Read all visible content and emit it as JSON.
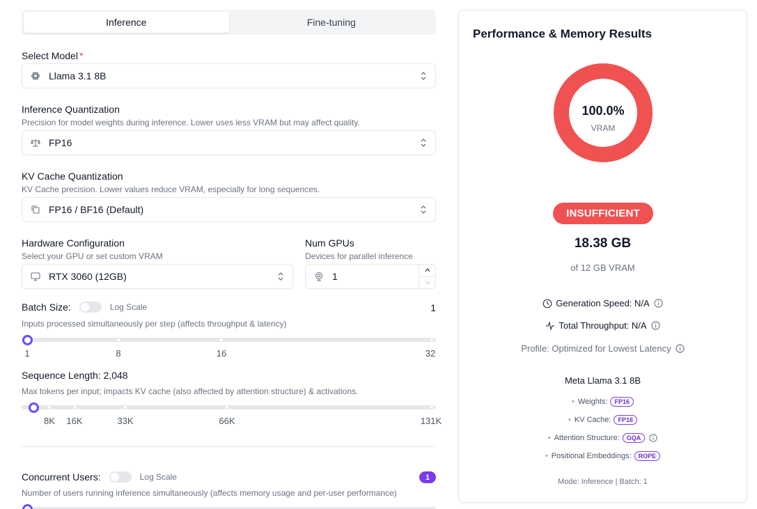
{
  "tabs": [
    {
      "label": "Inference",
      "active": true
    },
    {
      "label": "Fine-tuning",
      "active": false
    }
  ],
  "model": {
    "label": "Select Model",
    "required_mark": "*",
    "value": "Llama 3.1 8B",
    "icon": "openai-logo-icon"
  },
  "inference_quant": {
    "label": "Inference Quantization",
    "help": "Precision for model weights during inference. Lower uses less VRAM but may affect quality.",
    "value": "FP16",
    "icon": "scale-icon"
  },
  "kv_quant": {
    "label": "KV Cache Quantization",
    "help": "KV Cache precision. Lower values reduce VRAM, especially for long sequences.",
    "value": "FP16 / BF16 (Default)",
    "icon": "copy-icon"
  },
  "hardware": {
    "label": "Hardware Configuration",
    "help": "Select your GPU or set custom VRAM",
    "value": "RTX 3060 (12GB)",
    "icon": "monitor-icon"
  },
  "gpus": {
    "label": "Num GPUs",
    "help": "Devices for parallel inference",
    "value": "1",
    "icon": "webcam-icon"
  },
  "batch": {
    "label": "Batch Size:",
    "log_label": "Log Scale",
    "value": "1",
    "help": "Inputs processed simultaneously per step (affects throughput & latency)",
    "ticks": [
      "1",
      "8",
      "16",
      "32"
    ],
    "position": 0
  },
  "sequence": {
    "label": "Sequence Length: 2,048",
    "help": "Max tokens per input; impacts KV cache (also affected by attention structure) & activations.",
    "ticks": [
      "8K",
      "16K",
      "33K",
      "66K",
      "131K"
    ],
    "position": 0.015
  },
  "concurrent": {
    "label": "Concurrent Users:",
    "log_label": "Log Scale",
    "value": "1",
    "help": "Number of users running inference simultaneously (affects memory usage and per-user performance)"
  },
  "results": {
    "title": "Performance & Memory Results",
    "vram_pct": "100.0%",
    "vram_label": "VRAM",
    "vram_fill": 1.0,
    "status": "INSUFFICIENT",
    "usage": "18.38 GB",
    "usage_sub": "of 12 GB VRAM",
    "gen_speed": "Generation Speed: N/A",
    "throughput": "Total Throughput: N/A",
    "profile": "Profile: Optimized for Lowest Latency",
    "model_name": "Meta Llama 3.1 8B",
    "weights_label": "Weights:",
    "weights_tag": "FP16",
    "kv_label": "KV Cache:",
    "kv_tag": "FP16",
    "attn_label": "Attention Structure:",
    "attn_tag": "GQA",
    "pos_label": "Positional Embeddings:",
    "pos_tag": "ROPE",
    "mode": "Mode: Inference | Batch: 1",
    "colors": {
      "danger": "#f05252",
      "accent": "#7c3aed"
    }
  }
}
